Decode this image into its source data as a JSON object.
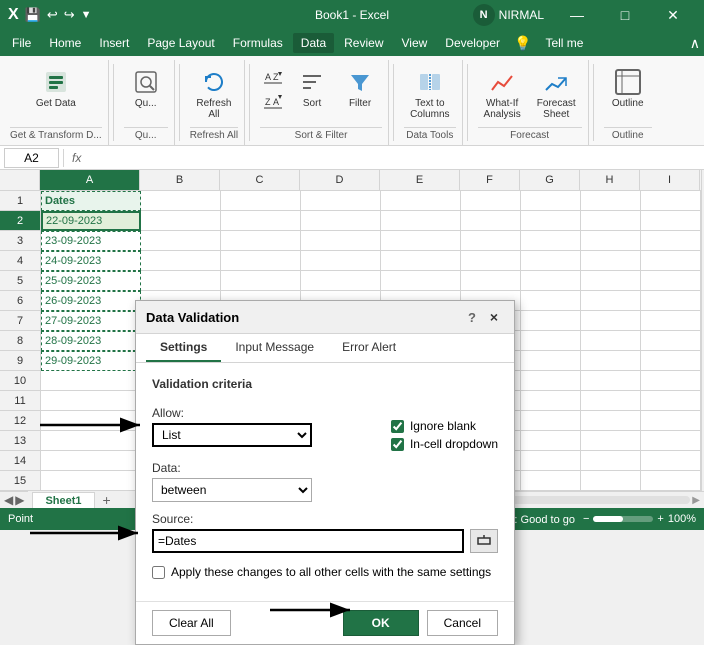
{
  "titlebar": {
    "title": "Book1 - Excel",
    "user": "NIRMAL",
    "user_initial": "N",
    "undo_icon": "↩",
    "redo_icon": "↪",
    "save_icon": "💾",
    "min_btn": "—",
    "max_btn": "□",
    "close_btn": "✕"
  },
  "menu": {
    "items": [
      "File",
      "Home",
      "Insert",
      "Page Layout",
      "Formulas",
      "Data",
      "Review",
      "View",
      "Developer",
      "Tell me"
    ]
  },
  "ribbon": {
    "get_transform_label": "Get & Transform D...",
    "queries_label": "Qu...",
    "get_data_label": "Get Data",
    "refresh_label": "Refresh\nAll",
    "sort_label": "Sort",
    "filter_label": "Filter",
    "text_to_cols_label": "Text to\nColumns",
    "whatif_label": "What-If\nAnalysis",
    "forecast_label": "Forecast\nSheet",
    "outline_label": "Outline",
    "sort_az": "A↓Z",
    "sort_za": "Z↑A",
    "filter_icon": "▼"
  },
  "formula_bar": {
    "cell_ref": "A2",
    "formula": ""
  },
  "spreadsheet": {
    "col_headers": [
      "A",
      "B",
      "C",
      "D",
      "E",
      "F",
      "G",
      "H",
      "I"
    ],
    "row_headers": [
      "1",
      "2",
      "3",
      "4",
      "5",
      "6",
      "7",
      "8",
      "9",
      "10",
      "11",
      "12",
      "13",
      "14",
      "15"
    ],
    "data": {
      "row1": [
        "Dates",
        "",
        "",
        "",
        "",
        "",
        "",
        "",
        ""
      ],
      "row2": [
        "22-09-2023",
        "",
        "",
        "",
        "",
        "",
        "",
        "",
        ""
      ],
      "row3": [
        "23-09-2023",
        "",
        "",
        "",
        "",
        "",
        "",
        "",
        ""
      ],
      "row4": [
        "24-09-2023",
        "",
        "",
        "",
        "",
        "",
        "",
        "",
        ""
      ],
      "row5": [
        "25-09-2023",
        "",
        "",
        "",
        "",
        "",
        "",
        "",
        ""
      ],
      "row6": [
        "26-09-2023",
        "",
        "",
        "",
        "",
        "",
        "",
        "",
        ""
      ],
      "row7": [
        "27-09-2023",
        "",
        "",
        "",
        "",
        "",
        "",
        "",
        ""
      ],
      "row8": [
        "28-09-2023",
        "",
        "",
        "",
        "",
        "",
        "",
        "",
        ""
      ],
      "row9": [
        "29-09-2023",
        "",
        "",
        "",
        "",
        "",
        "",
        "",
        ""
      ],
      "row10": [
        "",
        "",
        "",
        "",
        "",
        "",
        "",
        "",
        ""
      ],
      "row11": [
        "",
        "",
        "",
        "",
        "",
        "",
        "",
        "",
        ""
      ],
      "row12": [
        "",
        "",
        "",
        "",
        "",
        "",
        "",
        "",
        ""
      ],
      "row13": [
        "",
        "",
        "",
        "",
        "",
        "",
        "",
        "",
        ""
      ],
      "row14": [
        "",
        "",
        "",
        "",
        "",
        "",
        "",
        "",
        ""
      ],
      "row15": [
        "",
        "",
        "",
        "",
        "",
        "",
        "",
        "",
        ""
      ]
    }
  },
  "dialog": {
    "title": "Data Validation",
    "help": "?",
    "close": "×",
    "tabs": [
      "Settings",
      "Input Message",
      "Error Alert"
    ],
    "active_tab": "Settings",
    "section_title": "Validation criteria",
    "allow_label": "Allow:",
    "allow_value": "List",
    "data_label": "Data:",
    "data_value": "between",
    "ignore_blank_label": "Ignore blank",
    "in_cell_dropdown_label": "In-cell dropdown",
    "source_label": "Source:",
    "source_value": "=Dates",
    "apply_label": "Apply these changes to all other cells with the same settings",
    "clear_all": "Clear All",
    "ok": "OK",
    "cancel": "Cancel"
  },
  "sheet_tabs": [
    "Sheet1"
  ],
  "status_bar": {
    "left": "Point",
    "accessibility": "Accessibility: Good to go",
    "zoom": "100%"
  }
}
